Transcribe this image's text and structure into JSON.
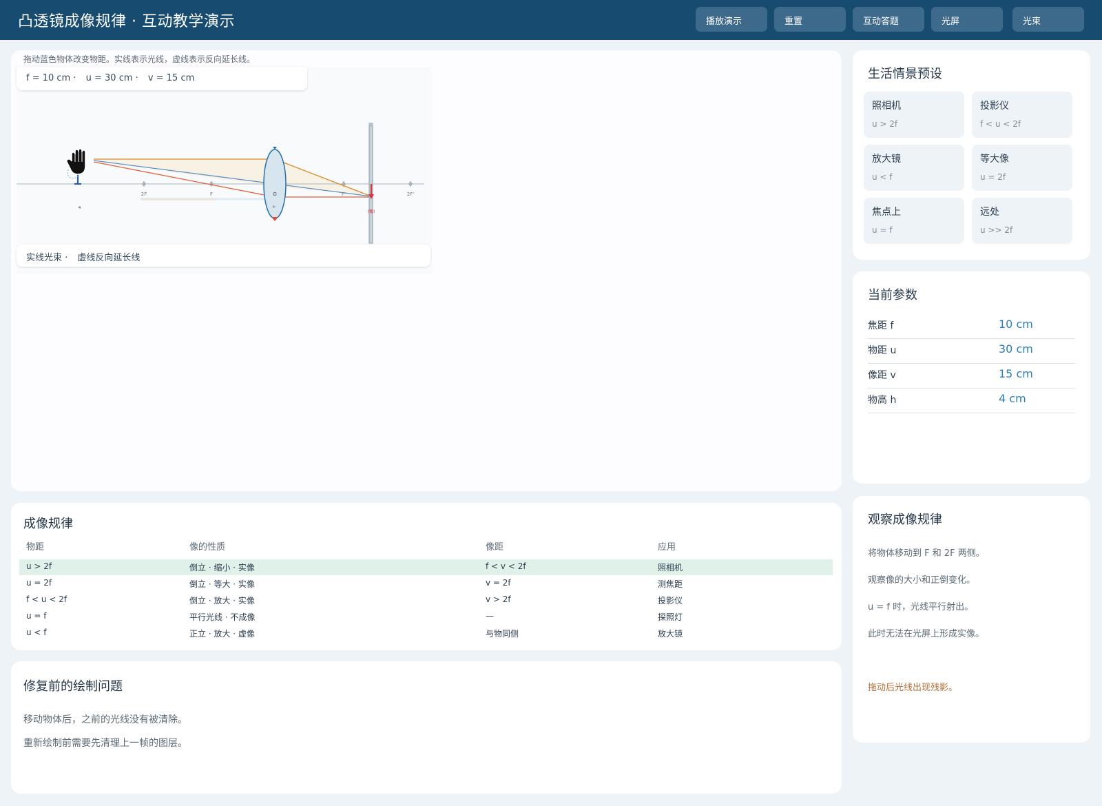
{
  "header": {
    "title": "凸透镜成像规律 ·   互动教学演示",
    "buttons": [
      "播放演示",
      "重置",
      "互动答题",
      "光屏",
      "光束"
    ]
  },
  "main": {
    "hint": "拖动蓝色物体改变物距。实线表示光线，虚线表示反向延长线。",
    "readout": [
      "f = 10 cm   ·",
      "u = 30 cm   ·",
      "v = 15 cm"
    ],
    "axis_labels": {
      "f2_left": "2F",
      "f_left": "F",
      "center": "O",
      "f_right": "F'",
      "f2_right": "2F'"
    },
    "legend": [
      "实线光束 ·",
      "虚线反向延长线"
    ]
  },
  "presets": {
    "title": "生活情景预设",
    "items": [
      {
        "name": "照相机",
        "cond": "u > 2f"
      },
      {
        "name": "投影仪",
        "cond": "f < u < 2f"
      },
      {
        "name": "放大镜",
        "cond": "u < f"
      },
      {
        "name": "等大像",
        "cond": "u = 2f"
      },
      {
        "name": "焦点上",
        "cond": "u = f"
      },
      {
        "name": "远处",
        "cond": "u >> 2f"
      }
    ]
  },
  "params": {
    "title": "当前参数",
    "rows": [
      {
        "label": "焦距 f",
        "value": "10 cm"
      },
      {
        "label": "物距 u",
        "value": "30 cm"
      },
      {
        "label": "像距 v",
        "value": "15 cm"
      },
      {
        "label": "物高 h",
        "value": "4 cm"
      }
    ]
  },
  "observe": {
    "title": "观察成像规律",
    "lines": [
      "将物体移动到 F 和 2F 两侧。",
      "观察像的大小和正倒变化。",
      "u = f 时，光线平行射出。",
      "此时无法在光屏上形成实像。"
    ],
    "warning": "拖动后光线出现残影。"
  },
  "rules": {
    "title": "成像规律",
    "headers": [
      "物距",
      "像的性质",
      "像距",
      "应用"
    ],
    "rows": [
      [
        "u > 2f",
        "倒立 ·   缩小 ·   实像",
        "f < v < 2f",
        "照相机"
      ],
      [
        "u = 2f",
        "倒立 ·   等大 ·   实像",
        "v = 2f",
        "测焦距"
      ],
      [
        "f < u < 2f",
        "倒立 ·   放大 ·   实像",
        "v > 2f",
        "投影仪"
      ],
      [
        "u = f",
        "平行光线 ·   不成像",
        "—",
        "探照灯"
      ],
      [
        "u < f",
        "正立 ·   放大 ·   虚像",
        "与物同侧",
        "放大镜"
      ]
    ]
  },
  "bugs": {
    "title": "修复前的绘制问题",
    "lines": [
      "移动物体后，之前的光线没有被清除。",
      "重新绘制前需要先清理上一帧的图层。"
    ]
  },
  "colors": {
    "header_bg": "#184b70",
    "accent_blue": "#2a7fb8",
    "ray_orange": "#d98a2b",
    "ray_red": "#e0603a",
    "ray_blue": "#5b8fc7",
    "highlight_row": "#dff1e8",
    "warning": "#b5703a"
  },
  "icons": {
    "cursor": "hand-grab-icon"
  }
}
